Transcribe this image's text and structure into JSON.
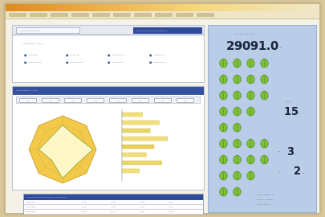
{
  "window": {
    "menu_count": 10
  },
  "top_panel": {
    "tabs": [
      "················",
      "························"
    ],
    "row_label": "·········· ·····",
    "grid": [
      "·······",
      "·······",
      "·········",
      "·········",
      "··········",
      "··········",
      "·········",
      "·········"
    ]
  },
  "chart_panel": {
    "header": "············ ····",
    "toolbar": [
      "····",
      "····",
      "····",
      "····",
      "····",
      "····",
      "····",
      "····"
    ],
    "radar": {
      "axes": 8,
      "outer": [
        1.0,
        1.0,
        1.0,
        1.0,
        1.0,
        1.0,
        1.0,
        1.0
      ],
      "inner": [
        0.72,
        0.55,
        0.9,
        0.6,
        0.85,
        0.45,
        0.7,
        0.5
      ]
    },
    "bars": [
      {
        "value": 0.32,
        "color": "#f1df7a"
      },
      {
        "value": 0.58,
        "color": "#f1df7a"
      },
      {
        "value": 0.44,
        "color": "#e9d66a"
      },
      {
        "value": 0.71,
        "color": "#f1df7a"
      },
      {
        "value": 0.5,
        "color": "#e6cf5a"
      },
      {
        "value": 0.38,
        "color": "#f1df7a"
      },
      {
        "value": 0.62,
        "color": "#e9d66a"
      },
      {
        "value": 0.27,
        "color": "#f1df7a"
      }
    ]
  },
  "table": {
    "header": "·························· ············",
    "rows": [
      [
        "··········",
        "·····",
        "·····",
        "·····",
        "·····"
      ],
      [
        "··········",
        "·····",
        "·····",
        "·····",
        "·····"
      ],
      [
        "··········",
        "·····",
        "·····",
        "·····",
        "·····"
      ]
    ]
  },
  "right_panel": {
    "counter_label": "········ ·······",
    "counter_value": "29091.0",
    "counter_unit": "·",
    "leaves_per_row": [
      4,
      4,
      4,
      3,
      2,
      4,
      4,
      3,
      2
    ],
    "stats": [
      {
        "label": "····",
        "value": "15",
        "unit": "·"
      },
      {
        "label": "··",
        "value": "3",
        "unit": "·"
      },
      {
        "label": "··",
        "value": "2",
        "unit": "··"
      }
    ],
    "footnote": [
      "···· ········ ·· ·",
      "·······  ········",
      "····· ······ ·"
    ]
  },
  "colors": {
    "leaf": "#7fbf3a",
    "leaf_dark": "#4f8f1f",
    "radar_fill": "#f3c94a",
    "radar_inner": "#fff7c8",
    "accent": "#2f4c9a"
  }
}
